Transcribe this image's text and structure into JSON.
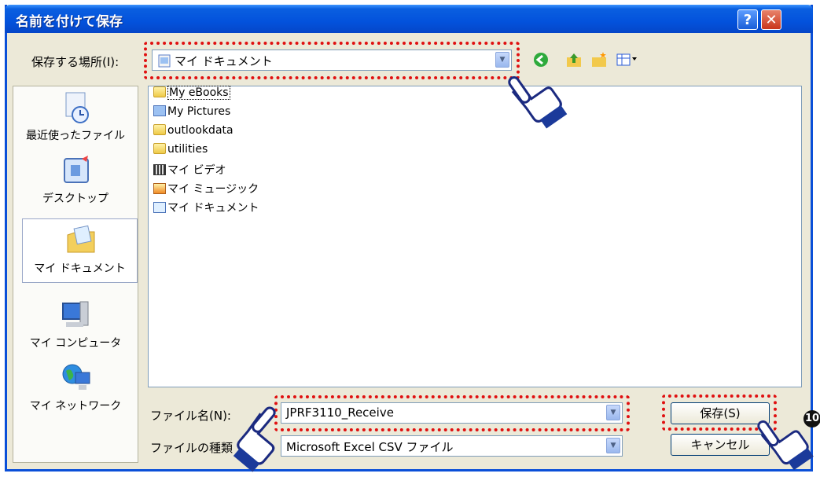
{
  "window": {
    "title": "名前を付けて保存",
    "help_label": "?",
    "close_label": "✕"
  },
  "location": {
    "label": "保存する場所(I):",
    "value": "マイ ドキュメント"
  },
  "places": [
    {
      "label": "最近使ったファイル",
      "icon": "recent-icon"
    },
    {
      "label": "デスクトップ",
      "icon": "desktop-icon"
    },
    {
      "label": "マイ ドキュメント",
      "icon": "my-documents-icon",
      "selected": true
    },
    {
      "label": "マイ コンピュータ",
      "icon": "my-computer-icon"
    },
    {
      "label": "マイ ネットワーク",
      "icon": "network-icon"
    }
  ],
  "files": [
    {
      "name": "My eBooks",
      "icon": "folder-icon"
    },
    {
      "name": "My Pictures",
      "icon": "pictures-folder-icon"
    },
    {
      "name": "outlookdata",
      "icon": "folder-icon"
    },
    {
      "name": "utilities",
      "icon": "folder-icon"
    },
    {
      "name": "マイ ビデオ",
      "icon": "video-folder-icon"
    },
    {
      "name": "マイ ミュージック",
      "icon": "music-folder-icon"
    },
    {
      "name": "マイ ドキュメント",
      "icon": "documents-shortcut-icon"
    }
  ],
  "filename": {
    "label": "ファイル名(N):",
    "value": "JPRF3110_Receive"
  },
  "filetype": {
    "label": "ファイルの種類",
    "value": "Microsoft Excel CSV ファイル"
  },
  "buttons": {
    "save": "保存(S)",
    "cancel": "キャンセル"
  },
  "step_number": "10",
  "colors": {
    "title_blue": "#0352dc",
    "highlight_red": "#e01010",
    "dialog_bg": "#ece9d8"
  }
}
